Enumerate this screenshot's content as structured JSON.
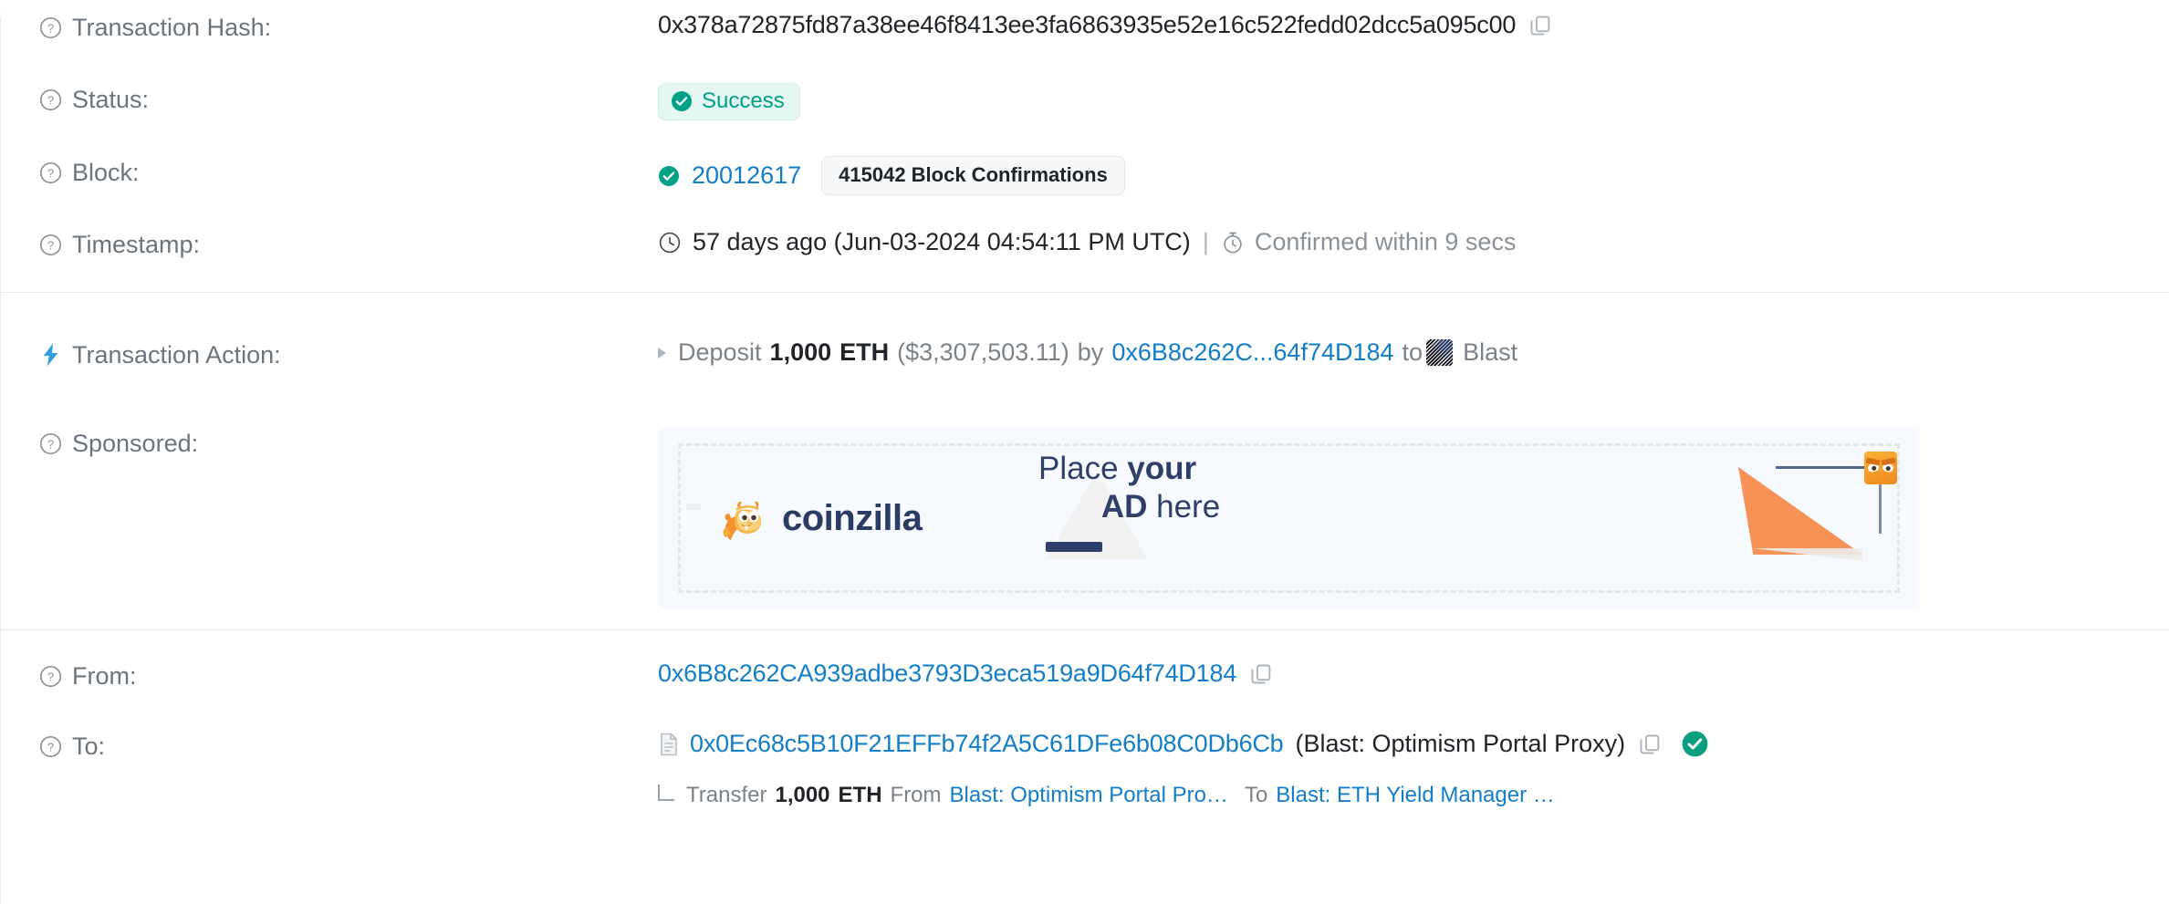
{
  "colors": {
    "link": "#127ec8",
    "success": "#00a186",
    "success_bg": "#e4f7f1",
    "muted": "#6c757e",
    "ad_bg": "#f6fafe",
    "ad_navy": "#2e4069",
    "ad_orange": "#f79256",
    "blast_bg": "#0d0d15"
  },
  "rows": {
    "transaction_hash": {
      "label": "Transaction Hash:",
      "help_icon": "question-circle-icon",
      "value": "0x378a72875fd87a38ee46f8413ee3fa6863935e52e16c522fedd02dcc5a095c00",
      "copy_icon": "copy-icon"
    },
    "status": {
      "label": "Status:",
      "help_icon": "question-circle-icon",
      "badge_text": "Success",
      "badge_icon": "check-circle-icon"
    },
    "block": {
      "label": "Block:",
      "help_icon": "question-circle-icon",
      "confirm_icon": "check-circle-icon",
      "number": "20012617",
      "confirmations": "415042 Block Confirmations"
    },
    "timestamp": {
      "label": "Timestamp:",
      "help_icon": "question-circle-icon",
      "clock_icon": "clock-icon",
      "age_and_date": "57 days ago (Jun-03-2024 04:54:11 PM UTC)",
      "separator": "|",
      "stopwatch_icon": "stopwatch-icon",
      "confirmed_within": "Confirmed within 9 secs"
    },
    "transaction_action": {
      "label": "Transaction Action:",
      "bolt_icon": "lightning-bolt-icon",
      "expand_icon": "caret-right-icon",
      "verb": "Deposit",
      "amount": "1,000",
      "token": "ETH",
      "usd_value": "($3,307,503.11)",
      "by_word": "by",
      "by_address": "0x6B8c262C...64f74D184",
      "to_word": "to",
      "dest_logo_icon": "blast-logo-icon",
      "dest_name": "Blast"
    },
    "sponsored": {
      "label": "Sponsored:",
      "help_icon": "question-circle-icon",
      "ad": {
        "brand": "coinzilla",
        "mascot_icon": "coinzilla-dragon-icon",
        "headline_line1_plain": "Place ",
        "headline_line1_bold": "your",
        "headline_line2_bold": "AD",
        "headline_line2_plain": " here",
        "flag_icon": "orange-flag-pennant-icon"
      }
    },
    "from": {
      "label": "From:",
      "help_icon": "question-circle-icon",
      "address": "0x6B8c262CA939adbe3793D3eca519a9D64f74D184",
      "copy_icon": "copy-icon"
    },
    "to": {
      "label": "To:",
      "help_icon": "question-circle-icon",
      "contract_icon": "contract-document-icon",
      "address": "0x0Ec68c5B10F21EFFb74f2A5C61DFe6b08C0Db6Cb",
      "name_tag": "(Blast: Optimism Portal Proxy)",
      "copy_icon": "copy-icon",
      "verified_icon": "verified-check-icon"
    },
    "transfer": {
      "corner_icon": "tree-corner-icon",
      "label": "Transfer",
      "amount": "1,000",
      "token": "ETH",
      "from_word": "From",
      "from_name": "Blast: Optimism Portal Pro…",
      "to_word": "To",
      "to_name": "Blast: ETH Yield Manager …"
    }
  }
}
